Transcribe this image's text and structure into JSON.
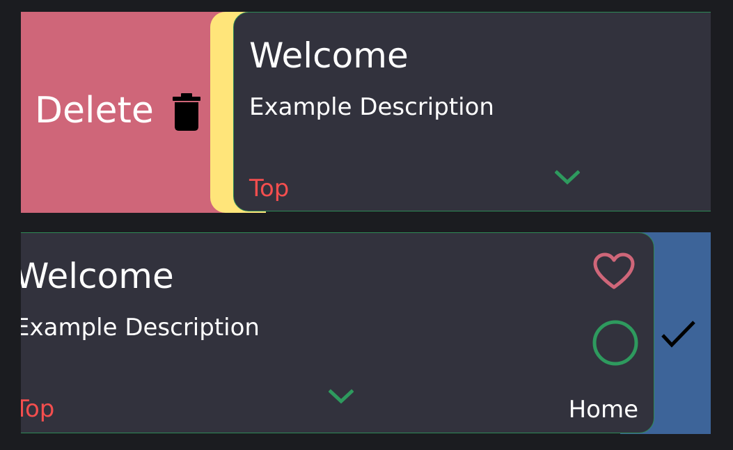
{
  "colors": {
    "background": "#1b1c20",
    "card": "#32323d",
    "card_border": "#2e8b57",
    "delete_action": "#cf6679",
    "secondary_action": "#ffe57a",
    "done_action": "#3d6499",
    "tag_text": "#f44e4e",
    "accent_green": "#2e9a5e",
    "heart": "#cf6679"
  },
  "rows": [
    {
      "swipe_action": {
        "label": "Delete",
        "icon": "trash-icon"
      },
      "card": {
        "title": "Welcome",
        "description": "Example Description",
        "tag": "Top",
        "expand_icon": "chevron-down-icon"
      }
    },
    {
      "swipe_action": {
        "icon": "check-icon"
      },
      "card": {
        "title": "Welcome",
        "description": "Example Description",
        "tag": "Top",
        "expand_icon": "chevron-down-icon",
        "favorite_icon": "heart-outline-icon",
        "status_icon": "circle-outline-icon",
        "location": "Home"
      }
    }
  ]
}
